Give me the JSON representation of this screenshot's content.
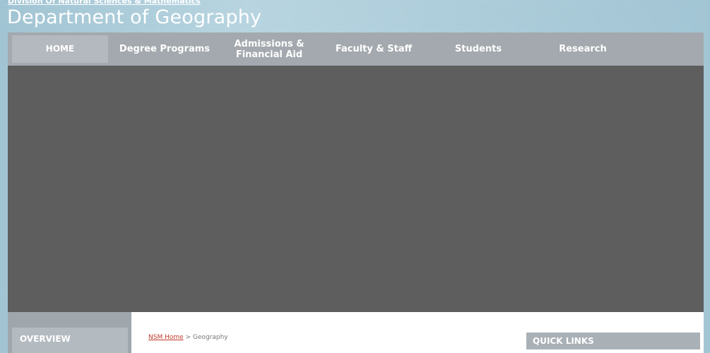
{
  "header": {
    "division_link": "Division Of Natural Sciences & Mathematics",
    "title": "Department of Geography"
  },
  "nav": {
    "items": [
      {
        "label": "HOME",
        "active": true
      },
      {
        "label": "Degree Programs",
        "active": false
      },
      {
        "label": "Admissions & Financial Aid",
        "active": false
      },
      {
        "label": "Faculty & Staff",
        "active": false
      },
      {
        "label": "Students",
        "active": false
      },
      {
        "label": "Research",
        "active": false
      }
    ]
  },
  "sidebar": {
    "overview_label": "OVERVIEW"
  },
  "breadcrumb": {
    "home_link": "NSM Home",
    "separator": " > ",
    "current": "Geography"
  },
  "quick_links": {
    "title": "QUICK LINKS"
  },
  "colors": {
    "background": "#a6c8d6",
    "nav_bar": "#a3a9ae",
    "nav_active": "#b3b9be",
    "hero": "#5e5e5e",
    "link": "#c0392b"
  }
}
